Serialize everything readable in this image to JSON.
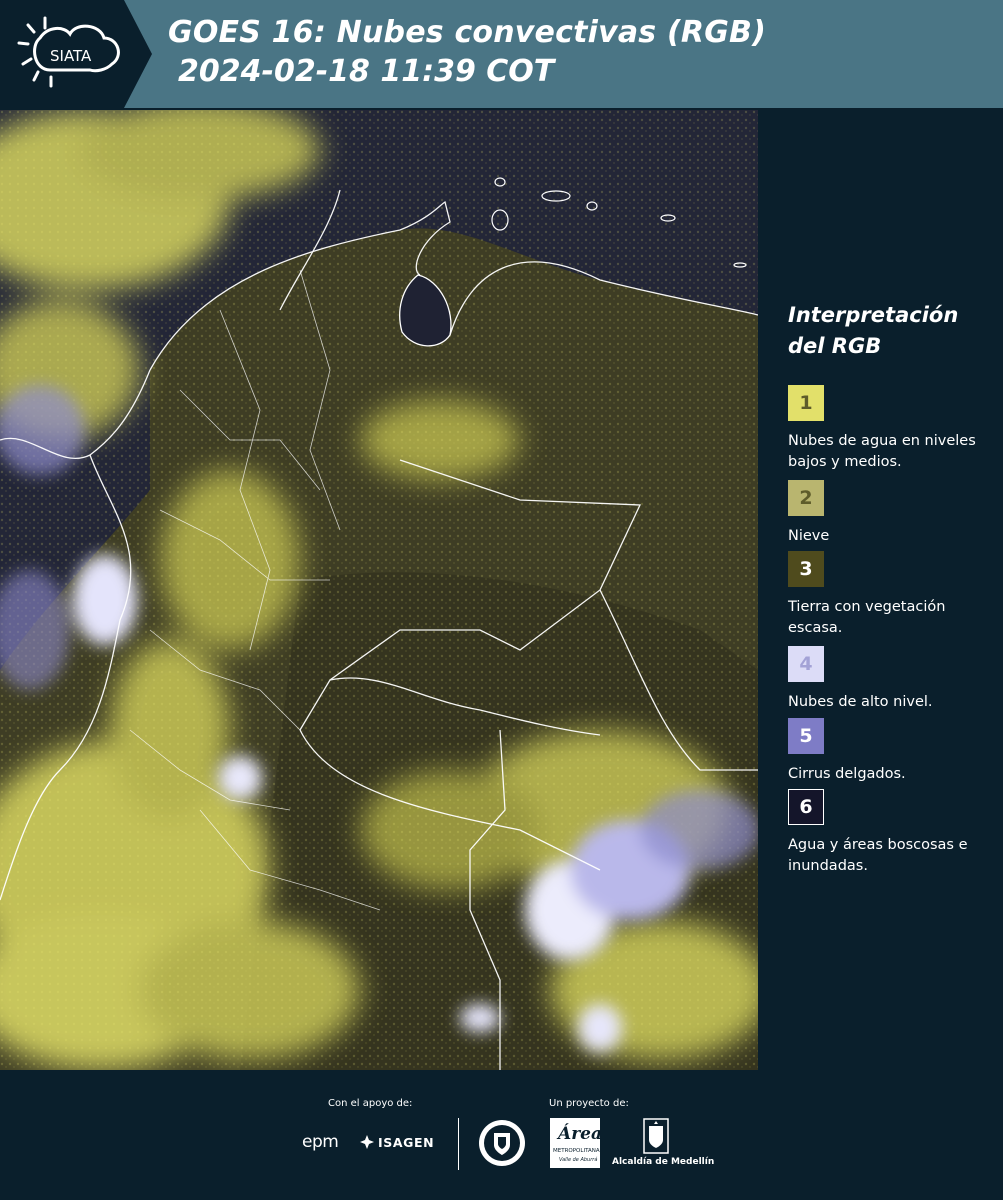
{
  "header": {
    "logo_text": "SIATA",
    "title": "GOES 16: Nubes convectivas (RGB)",
    "subtitle": "2024-02-18 11:39 COT"
  },
  "legend": {
    "title_line1": "Interpretación",
    "title_line2": "del RGB",
    "items": [
      {
        "number": "1",
        "label": "Nubes de agua en niveles bajos y medios.",
        "color": "#e2e06a"
      },
      {
        "number": "2",
        "label": "Nieve",
        "color": "#b9b56f"
      },
      {
        "number": "3",
        "label": "Tierra con vegetación escasa.",
        "color": "#4f4b1d"
      },
      {
        "number": "4",
        "label": "Nubes de alto nivel.",
        "color": "#dcdcf7"
      },
      {
        "number": "5",
        "label": "Cirrus delgados.",
        "color": "#7e7cc6"
      },
      {
        "number": "6",
        "label": "Agua y áreas boscosas e inundadas.",
        "color": "#14152a"
      }
    ]
  },
  "footer": {
    "support_label": "Con el apoyo de:",
    "project_label": "Un proyecto de:",
    "sponsor_epm": "epm",
    "sponsor_isagen": "ISAGEN",
    "area_logo_text": "Área",
    "area_logo_sub1": "METROPOLITANA",
    "area_logo_sub2": "Valle de Aburrá",
    "alcaldia": "Alcaldía de Medellín"
  }
}
